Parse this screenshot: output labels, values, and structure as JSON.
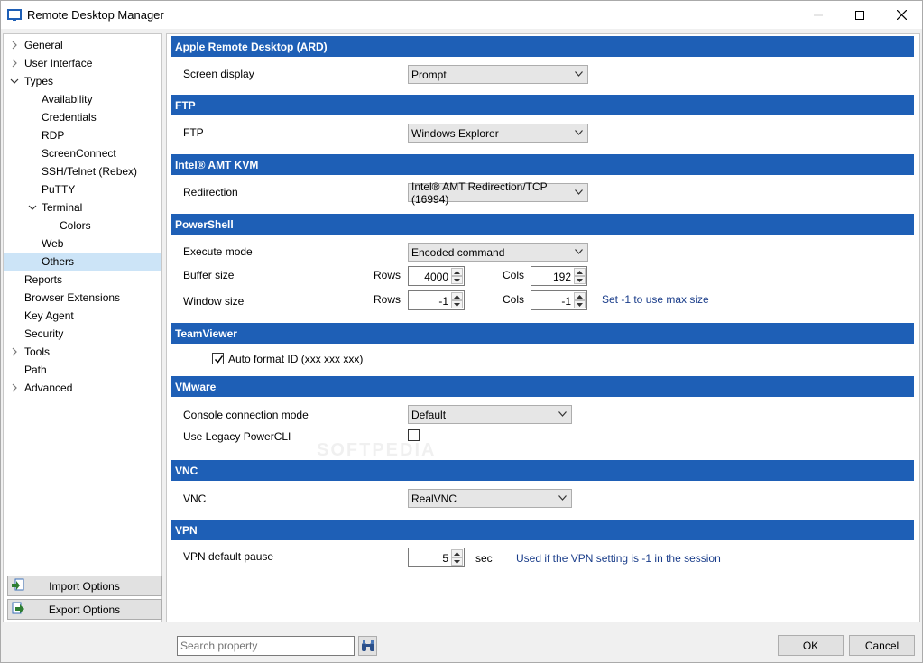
{
  "window": {
    "title": "Remote Desktop Manager",
    "accent": "#1e5fb6",
    "selection": "#cce4f7"
  },
  "sidebar": {
    "items": [
      {
        "label": "General",
        "chevron": "right"
      },
      {
        "label": "User Interface",
        "chevron": "right"
      },
      {
        "label": "Types",
        "chevron": "down"
      },
      {
        "label": "Availability",
        "chevron": ""
      },
      {
        "label": "Credentials",
        "chevron": ""
      },
      {
        "label": "RDP",
        "chevron": ""
      },
      {
        "label": "ScreenConnect",
        "chevron": ""
      },
      {
        "label": "SSH/Telnet (Rebex)",
        "chevron": ""
      },
      {
        "label": "PuTTY",
        "chevron": ""
      },
      {
        "label": "Terminal",
        "chevron": "down"
      },
      {
        "label": "Colors",
        "chevron": ""
      },
      {
        "label": "Web",
        "chevron": ""
      },
      {
        "label": "Others",
        "chevron": "",
        "selected": true
      },
      {
        "label": "Reports",
        "chevron": ""
      },
      {
        "label": "Browser Extensions",
        "chevron": ""
      },
      {
        "label": "Key Agent",
        "chevron": ""
      },
      {
        "label": "Security",
        "chevron": ""
      },
      {
        "label": "Tools",
        "chevron": "right"
      },
      {
        "label": "Path",
        "chevron": ""
      },
      {
        "label": "Advanced",
        "chevron": "right"
      }
    ],
    "import_label": "Import Options",
    "export_label": "Export Options"
  },
  "sections": {
    "ard": {
      "title": "Apple Remote Desktop (ARD)",
      "screen_display_label": "Screen display",
      "screen_display_value": "Prompt"
    },
    "ftp": {
      "title": "FTP",
      "ftp_label": "FTP",
      "ftp_value": "Windows Explorer"
    },
    "amt": {
      "title": "Intel® AMT KVM",
      "redirection_label": "Redirection",
      "redirection_value": "Intel® AMT Redirection/TCP (16994)"
    },
    "powershell": {
      "title": "PowerShell",
      "execute_mode_label": "Execute mode",
      "execute_mode_value": "Encoded command",
      "buffer_size_label": "Buffer size",
      "window_size_label": "Window size",
      "rows_label": "Rows",
      "cols_label": "Cols",
      "buffer_rows": "4000",
      "buffer_cols": "192",
      "window_rows": "-1",
      "window_cols": "-1",
      "window_hint": "Set -1 to use max size"
    },
    "teamviewer": {
      "title": "TeamViewer",
      "auto_format_label": "Auto format ID (xxx xxx xxx)",
      "auto_format_checked": true
    },
    "vmware": {
      "title": "VMware",
      "console_mode_label": "Console connection mode",
      "console_mode_value": "Default",
      "legacy_label": "Use Legacy PowerCLI",
      "legacy_checked": false
    },
    "vnc": {
      "title": "VNC",
      "vnc_label": "VNC",
      "vnc_value": "RealVNC"
    },
    "vpn": {
      "title": "VPN",
      "pause_label": "VPN default pause",
      "pause_value": "5",
      "pause_unit": "sec",
      "pause_hint": "Used if the VPN setting is -1 in the session"
    }
  },
  "footer": {
    "search_placeholder": "Search property",
    "ok_label": "OK",
    "cancel_label": "Cancel"
  }
}
